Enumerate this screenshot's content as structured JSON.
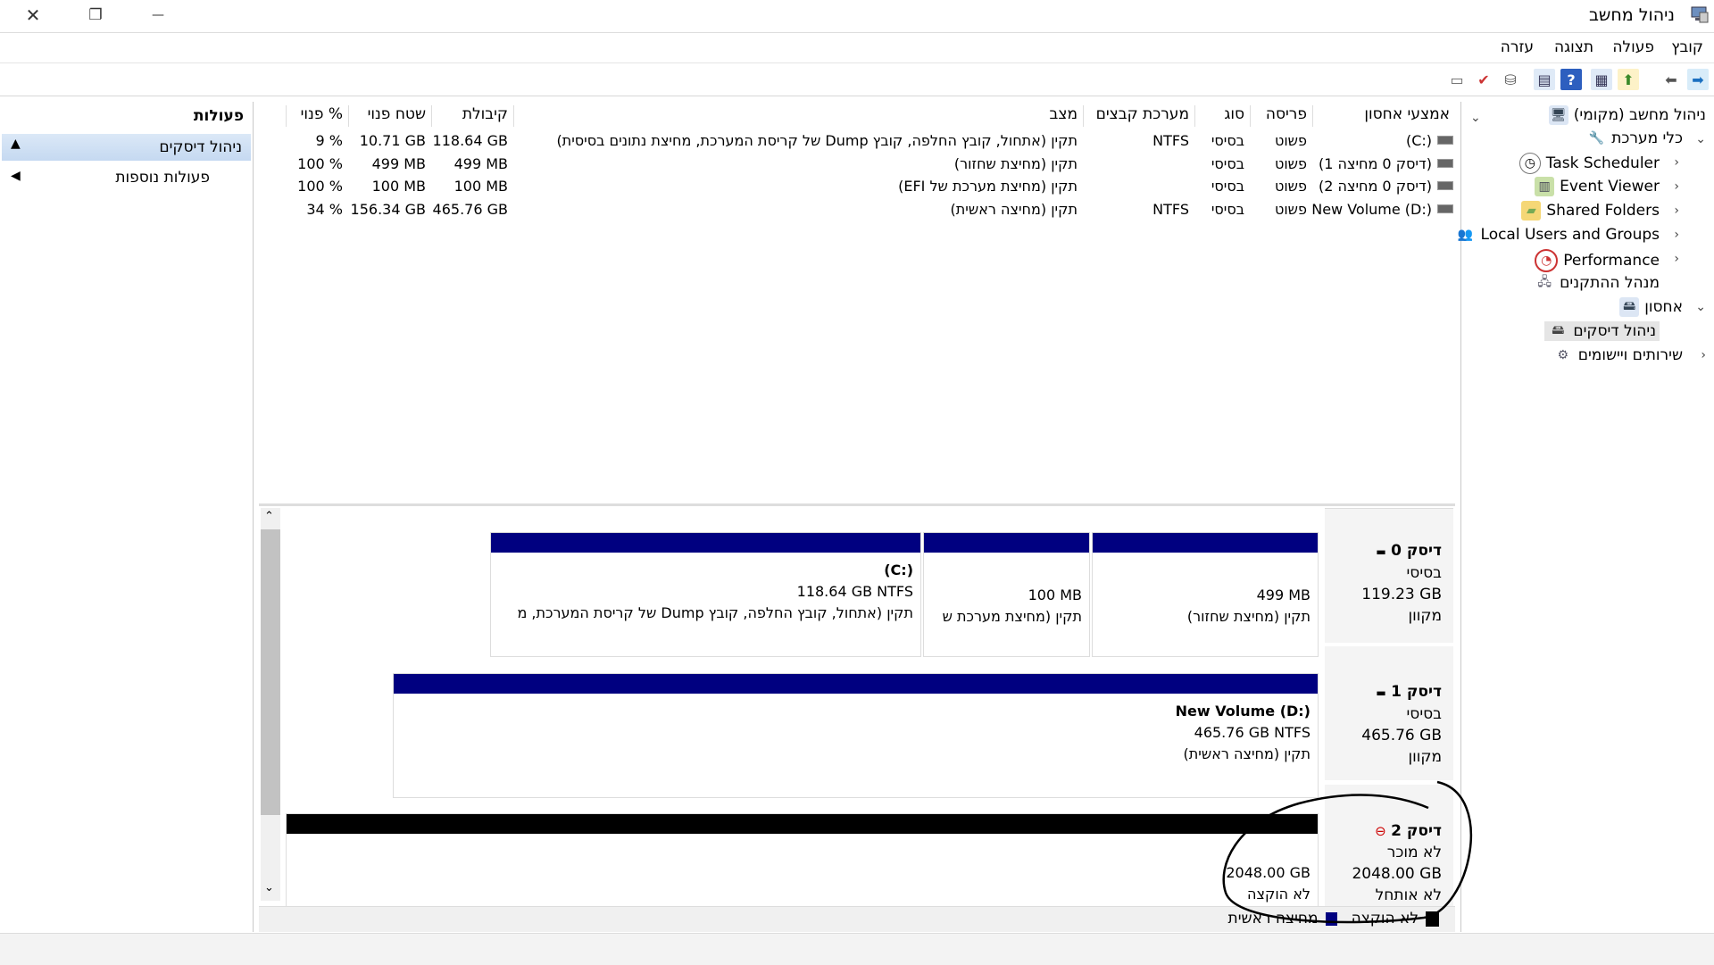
{
  "window": {
    "title": "ניהול מחשב",
    "close_glyph": "✕",
    "restore_glyph": "❐",
    "minimize_glyph": "—"
  },
  "menu": [
    "קובץ",
    "פעולה",
    "תצוגה",
    "עזרה"
  ],
  "tree": {
    "root": "ניהול מחשב (מקומי)",
    "system_tools": "כלי מערכת",
    "task_scheduler": "Task Scheduler",
    "event_viewer": "Event Viewer",
    "shared_folders": "Shared Folders",
    "local_users": "Local Users and Groups",
    "performance": "Performance",
    "device_manager": "מנהל ההתקנים",
    "storage": "אחסון",
    "disk_management": "ניהול דיסקים",
    "services": "שירותים ויישומים"
  },
  "volume_table": {
    "headers": [
      "אמצעי אחסון",
      "פריסה",
      "סוג",
      "מערכת קבצים",
      "מצב",
      "קיבולת",
      "שטח פנוי",
      "% פנוי"
    ],
    "rows": [
      [
        "(C:)",
        "פשוט",
        "בסיסי",
        "NTFS",
        "תקין (אתחול, קובץ החלפה, קובץ Dump של קריסת המערכת, מחיצת נתונים בסיסית)",
        "118.64 GB",
        "10.71 GB",
        "9 %"
      ],
      [
        "(דיסק 0 מחיצה 1)",
        "פשוט",
        "בסיסי",
        "",
        "תקין (מחיצת שחזור)",
        "499 MB",
        "499 MB",
        "100 %"
      ],
      [
        "(דיסק 0 מחיצה 2)",
        "פשוט",
        "בסיסי",
        "",
        "תקין (מחיצת מערכת של EFI)",
        "100 MB",
        "100 MB",
        "100 %"
      ],
      [
        "New Volume (D:)",
        "פשוט",
        "בסיסי",
        "NTFS",
        "תקין (מחיצה ראשית)",
        "465.76 GB",
        "156.34 GB",
        "34 %"
      ]
    ]
  },
  "disks": [
    {
      "name": "דיסק 0",
      "type": "בסיסי",
      "size": "119.23 GB",
      "status": "מקוון",
      "partitions": [
        {
          "label": "",
          "size": "499 MB",
          "desc": "תקין (מחיצת שחזור)"
        },
        {
          "label": "",
          "size": "100 MB",
          "desc": "תקין (מחיצת מערכת ש"
        },
        {
          "label": "(C:)",
          "size": "118.64 GB NTFS",
          "desc": "תקין (אתחול, קובץ החלפה, קובץ Dump של קריסת המערכת, מ"
        }
      ]
    },
    {
      "name": "דיסק 1",
      "type": "בסיסי",
      "size": "465.76 GB",
      "status": "מקוון",
      "partitions": [
        {
          "label": "New Volume  (D:)",
          "size": "465.76 GB NTFS",
          "desc": "תקין (מחיצה ראשית)"
        }
      ]
    },
    {
      "name": "דיסק 2",
      "type": "לא מוכר",
      "size": "2048.00 GB",
      "status": "לא אותחל",
      "partitions": [
        {
          "label": "",
          "size": "2048.00 GB",
          "desc": "לא הוקצה"
        }
      ]
    }
  ],
  "legend": {
    "unallocated": "לא הוקצה",
    "primary": "מחיצה ראשית"
  },
  "actions": {
    "header": "פעולות",
    "section": "ניהול דיסקים",
    "more": "פעולות נוספות"
  },
  "colors": {
    "primary_partition": "#000080",
    "unallocated": "#000000",
    "annotation": "#000000"
  }
}
